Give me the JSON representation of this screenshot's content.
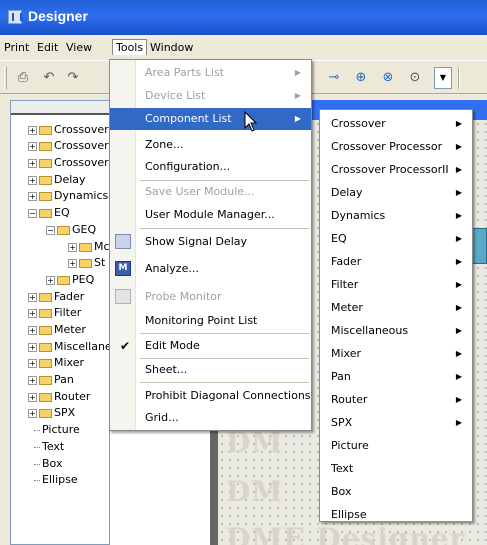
{
  "window": {
    "title": "Designer"
  },
  "menubar": {
    "items": [
      {
        "label": "Print"
      },
      {
        "label": "Edit"
      },
      {
        "label": "View"
      },
      {
        "label": "Tools"
      },
      {
        "label": "Window"
      }
    ]
  },
  "toolbar": {
    "icons": [
      "print-icon",
      "undo-icon",
      "redo-icon",
      "wire-icon",
      "add-port-icon",
      "remove-port-icon",
      "port-icon",
      "dropdown-icon"
    ]
  },
  "tree": {
    "items": [
      {
        "label": "Crossover"
      },
      {
        "label": "Crossover I"
      },
      {
        "label": "Crossover I"
      },
      {
        "label": "Delay"
      },
      {
        "label": "Dynamics"
      },
      {
        "label": "EQ"
      },
      {
        "label": "GEQ"
      },
      {
        "label": "Mc"
      },
      {
        "label": "St"
      },
      {
        "label": "PEQ"
      },
      {
        "label": "Fader"
      },
      {
        "label": "Filter"
      },
      {
        "label": "Meter"
      },
      {
        "label": "Miscellanec"
      },
      {
        "label": "Mixer"
      },
      {
        "label": "Pan"
      },
      {
        "label": "Router"
      },
      {
        "label": "SPX"
      },
      {
        "label": "Picture"
      },
      {
        "label": "Text"
      },
      {
        "label": "Box"
      },
      {
        "label": "Ellipse"
      }
    ]
  },
  "canvas": {
    "watermark": "DME Designer",
    "watermark_short": "DM"
  },
  "tools_menu": {
    "items": [
      {
        "label": "Area Parts List",
        "state": "disabled",
        "submenu": true
      },
      {
        "label": "Device List",
        "state": "disabled",
        "submenu": true
      },
      {
        "label": "Component List",
        "state": "highlighted",
        "submenu": true
      },
      {
        "label": "Zone..."
      },
      {
        "label": "Configuration..."
      },
      {
        "label": "Save User Module...",
        "state": "disabled"
      },
      {
        "label": "User Module Manager..."
      },
      {
        "label": "Show Signal Delay",
        "icon": "signal-delay-icon"
      },
      {
        "label": "Analyze...",
        "icon": "analyze-icon"
      },
      {
        "label": "Probe Monitor",
        "state": "disabled",
        "icon": "probe-icon"
      },
      {
        "label": "Monitoring Point List"
      },
      {
        "label": "Edit Mode",
        "checked": true
      },
      {
        "label": "Sheet..."
      },
      {
        "label": "Prohibit Diagonal Connections"
      },
      {
        "label": "Grid..."
      }
    ]
  },
  "component_menu": {
    "items": [
      {
        "label": "Crossover",
        "submenu": true
      },
      {
        "label": "Crossover Processor",
        "submenu": true
      },
      {
        "label": "Crossover ProcessorII",
        "submenu": true
      },
      {
        "label": "Delay",
        "submenu": true
      },
      {
        "label": "Dynamics",
        "submenu": true
      },
      {
        "label": "EQ",
        "submenu": true
      },
      {
        "label": "Fader",
        "submenu": true
      },
      {
        "label": "Filter",
        "submenu": true
      },
      {
        "label": "Meter",
        "submenu": true
      },
      {
        "label": "Miscellaneous",
        "submenu": true
      },
      {
        "label": "Mixer",
        "submenu": true
      },
      {
        "label": "Pan",
        "submenu": true
      },
      {
        "label": "Router",
        "submenu": true
      },
      {
        "label": "SPX",
        "submenu": true
      },
      {
        "label": "Picture",
        "submenu": false
      },
      {
        "label": "Text",
        "submenu": false
      },
      {
        "label": "Box",
        "submenu": false
      },
      {
        "label": "Ellipse",
        "submenu": false
      }
    ]
  },
  "colors": {
    "titlebar": "#2f6ff0",
    "highlight": "#3169c6",
    "menubar": "#ece9d8"
  }
}
